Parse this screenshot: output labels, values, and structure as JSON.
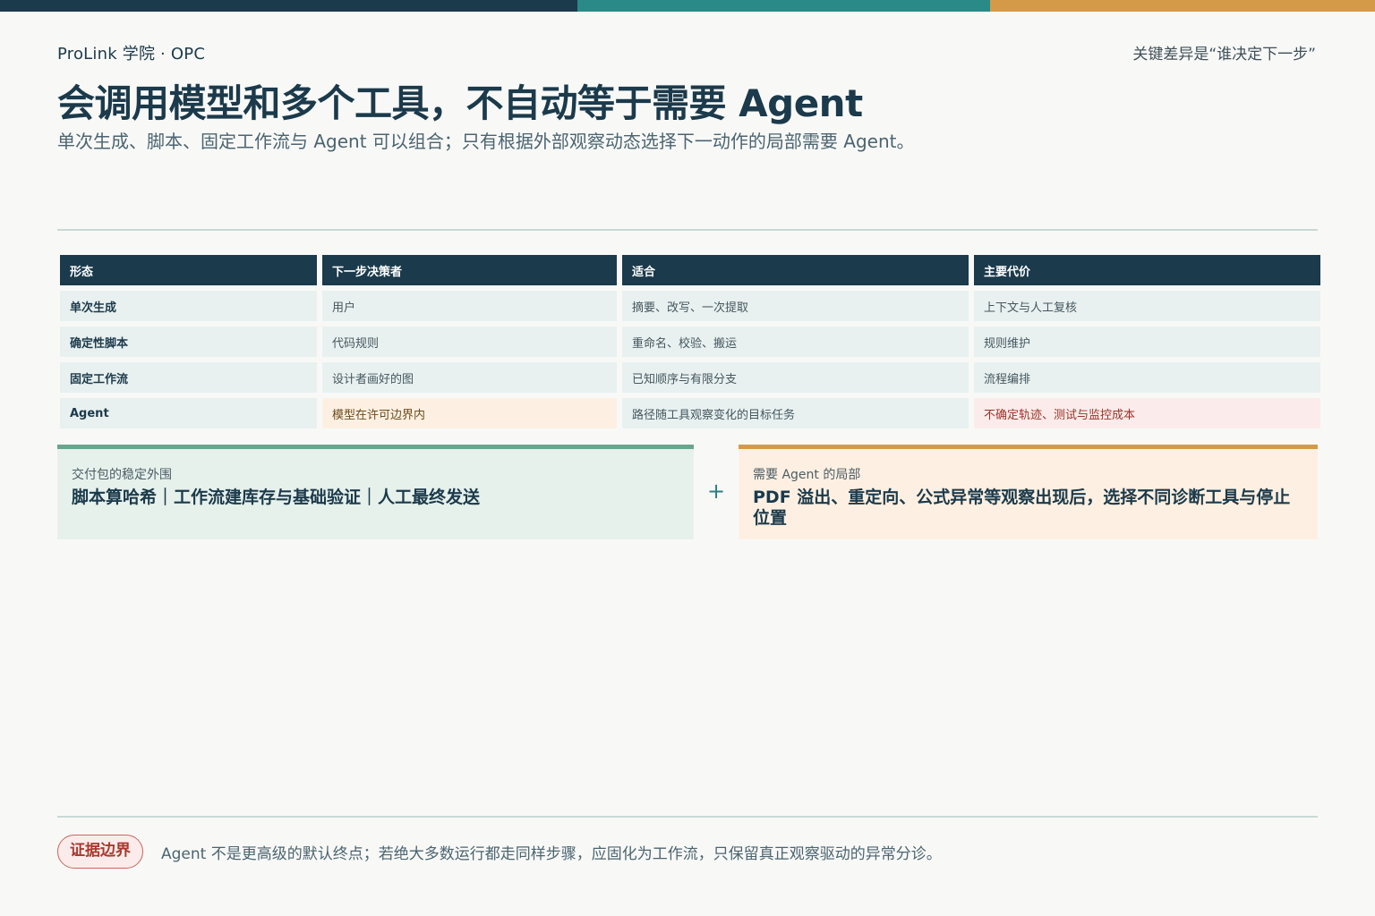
{
  "colors": {
    "navy": "#1b3a4b",
    "teal": "#2a8a87",
    "amber": "#d59a47",
    "green_accent": "#6aa58d",
    "red_accent": "#a73a2e"
  },
  "header": {
    "brand": "ProLink 学院 · OPC",
    "key_note": "关键差异是“谁决定下一步”",
    "title": "会调用模型和多个工具，不自动等于需要 Agent",
    "subtitle": "单次生成、脚本、固定工作流与 Agent 可以组合；只有根据外部观察动态选择下一动作的局部需要 Agent。"
  },
  "table": {
    "headers": [
      "形态",
      "下一步决策者",
      "适合",
      "主要代价"
    ],
    "rows": [
      [
        "单次生成",
        "用户",
        "摘要、改写、一次提取",
        "上下文与人工复核"
      ],
      [
        "确定性脚本",
        "代码规则",
        "重命名、校验、搬运",
        "规则维护"
      ],
      [
        "固定工作流",
        "设计者画好的图",
        "已知顺序与有限分支",
        "流程编排"
      ],
      [
        "Agent",
        "模型在许可边界内",
        "路径随工具观察变化的目标任务",
        "不确定轨迹、测试与监控成本"
      ]
    ]
  },
  "panels": {
    "left": {
      "label": "交付包的稳定外围",
      "body": "脚本算哈希｜工作流建库存与基础验证｜人工最终发送"
    },
    "plus": "+",
    "right": {
      "label": "需要 Agent 的局部",
      "body": "PDF 溢出、重定向、公式异常等观察出现后，选择不同诊断工具与停止位置"
    }
  },
  "footer": {
    "badge": "证据边界",
    "note": "Agent 不是更高级的默认终点；若绝大多数运行都走同样步骤，应固化为工作流，只保留真正观察驱动的异常分诊。"
  }
}
